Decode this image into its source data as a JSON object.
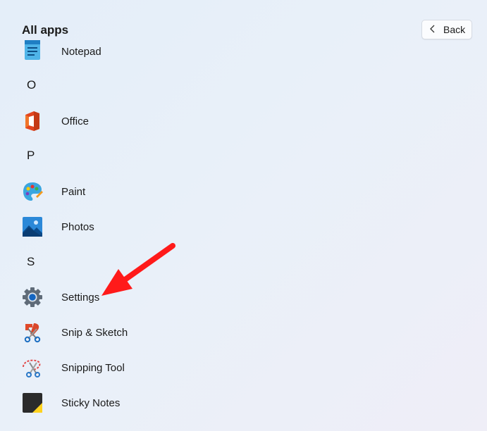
{
  "header": {
    "title": "All apps",
    "back_label": "Back"
  },
  "apps": [
    {
      "type": "app",
      "label": "Notepad",
      "icon": "notepad-icon"
    },
    {
      "type": "letter",
      "label": "O"
    },
    {
      "type": "app",
      "label": "Office",
      "icon": "office-icon"
    },
    {
      "type": "letter",
      "label": "P"
    },
    {
      "type": "app",
      "label": "Paint",
      "icon": "paint-icon"
    },
    {
      "type": "app",
      "label": "Photos",
      "icon": "photos-icon"
    },
    {
      "type": "letter",
      "label": "S"
    },
    {
      "type": "app",
      "label": "Settings",
      "icon": "settings-icon"
    },
    {
      "type": "app",
      "label": "Snip & Sketch",
      "icon": "snip-sketch-icon"
    },
    {
      "type": "app",
      "label": "Snipping Tool",
      "icon": "snipping-tool-icon"
    },
    {
      "type": "app",
      "label": "Sticky Notes",
      "icon": "sticky-notes-icon"
    }
  ],
  "annotation": {
    "icon": "red-arrow-icon",
    "color": "#ff1a1a"
  }
}
